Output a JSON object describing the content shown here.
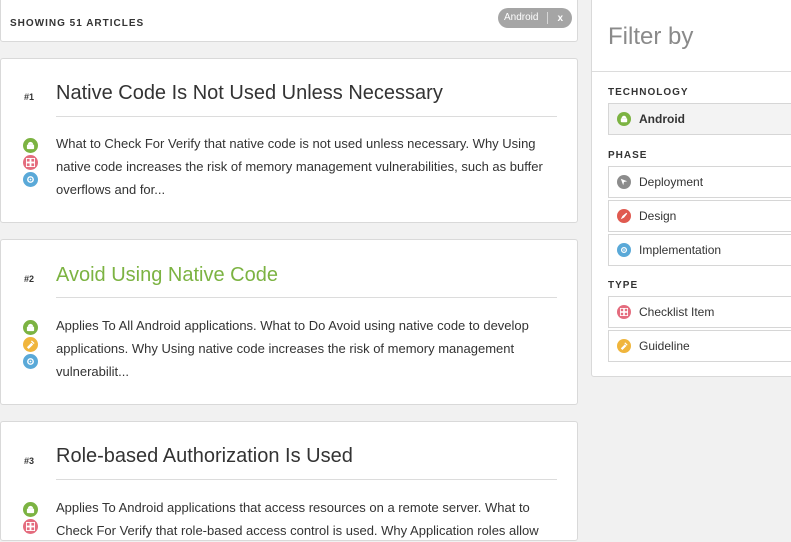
{
  "results": {
    "count_label": "SHOWING 51 ARTICLES",
    "active_filter": "Android",
    "remove_label": "x"
  },
  "articles": [
    {
      "number": "#1",
      "title": "Native Code Is Not Used Unless Necessary",
      "excerpt": "What to Check For Verify that native code is not used unless necessary. Why Using native code increases the risk of memory management vulnerabilities, such as buffer overflows and for...",
      "icons": [
        "android-icon",
        "checklist-icon",
        "implementation-icon"
      ]
    },
    {
      "number": "#2",
      "title": "Avoid Using Native Code",
      "excerpt": "Applies To All Android applications. What to Do Avoid using native code to develop applications. Why Using native code increases the risk of memory management vulnerabilit...",
      "icons": [
        "android-icon",
        "guideline-icon",
        "implementation-icon"
      ]
    },
    {
      "number": "#3",
      "title": "Role-based Authorization Is Used",
      "excerpt": "Applies To Android applications that access resources on a remote server. What to Check For Verify that role-based access control is used. Why Application roles allow",
      "icons": [
        "android-icon",
        "checklist-icon"
      ]
    }
  ],
  "filter": {
    "title": "Filter by",
    "technology_label": "TECHNOLOGY",
    "technology_items": [
      {
        "label": "Android",
        "icon": "android-icon",
        "selected": true
      }
    ],
    "phase_label": "PHASE",
    "phase_items": [
      {
        "label": "Deployment",
        "icon": "deployment-icon"
      },
      {
        "label": "Design",
        "icon": "design-icon"
      },
      {
        "label": "Implementation",
        "icon": "implementation-icon"
      }
    ],
    "type_label": "TYPE",
    "type_items": [
      {
        "label": "Checklist Item",
        "icon": "checklist-icon"
      },
      {
        "label": "Guideline",
        "icon": "guideline-icon"
      }
    ]
  },
  "colors": {
    "accent_green": "#7cb342",
    "checklist_pink": "#e46c7e",
    "implementation_blue": "#5aa9d8",
    "guideline_orange": "#f0b53c",
    "deployment_gray": "#8c8c8c",
    "design_red": "#e05a50"
  }
}
